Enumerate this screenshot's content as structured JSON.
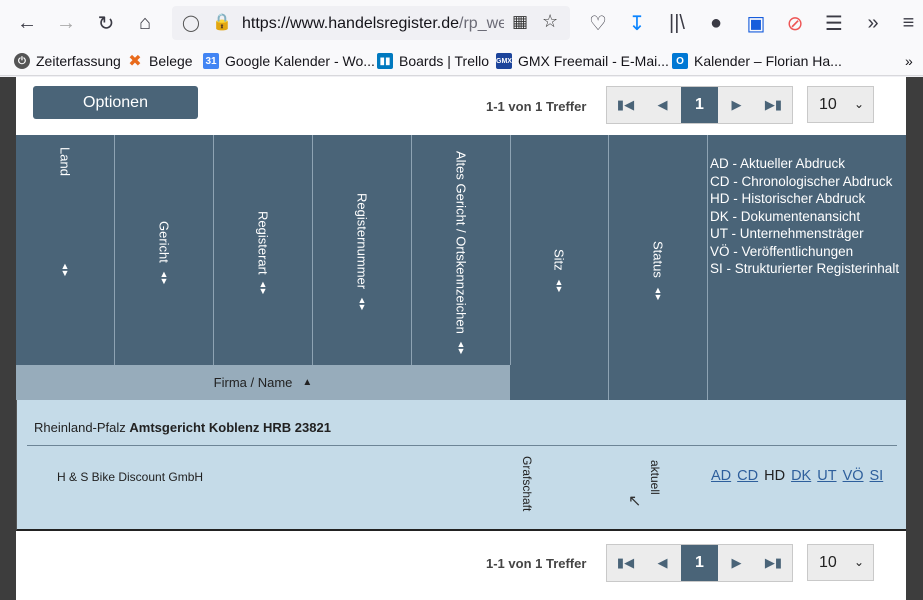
{
  "browser": {
    "url_main": "https://www.handelsregister.de",
    "url_path": "/rp_web",
    "bookmarks": [
      {
        "label": "Zeiterfassung"
      },
      {
        "label": "Belege"
      },
      {
        "label": "Google Kalender - Wo..."
      },
      {
        "label": "Boards | Trello"
      },
      {
        "label": "GMX Freemail - E-Mai..."
      },
      {
        "label": "Kalender – Florian Ha..."
      }
    ]
  },
  "top": {
    "options_label": "Optionen",
    "hits": "1-1 von 1 Treffer",
    "page": "1",
    "per_page": "10"
  },
  "columns": {
    "land": "Land",
    "gericht": "Gericht",
    "registerart": "Registerart",
    "registernummer": "Registernummer",
    "altes_gericht": "Altes Gericht / Ortskennzeichen",
    "sitz": "Sitz",
    "status": "Status",
    "firma": "Firma / Name"
  },
  "legend": [
    "AD - Aktueller Abdruck",
    "CD - Chronologischer Abdruck",
    "HD - Historischer Abdruck",
    "DK - Dokumentenansicht",
    "UT - Unternehmensträger",
    "VÖ - Veröffentlichungen",
    "SI - Strukturierter Registerinhalt"
  ],
  "result": {
    "state": "Rheinland-Pfalz",
    "court": "Amtsgericht Koblenz HRB 23821",
    "company": "H & S Bike Discount GmbH",
    "sitz": "Grafschaft",
    "status": "aktuell",
    "docs": [
      "AD",
      "CD",
      "HD",
      "DK",
      "UT",
      "VÖ",
      "SI"
    ]
  },
  "bottom": {
    "hits": "1-1 von 1 Treffer",
    "page": "1",
    "per_page": "10"
  }
}
